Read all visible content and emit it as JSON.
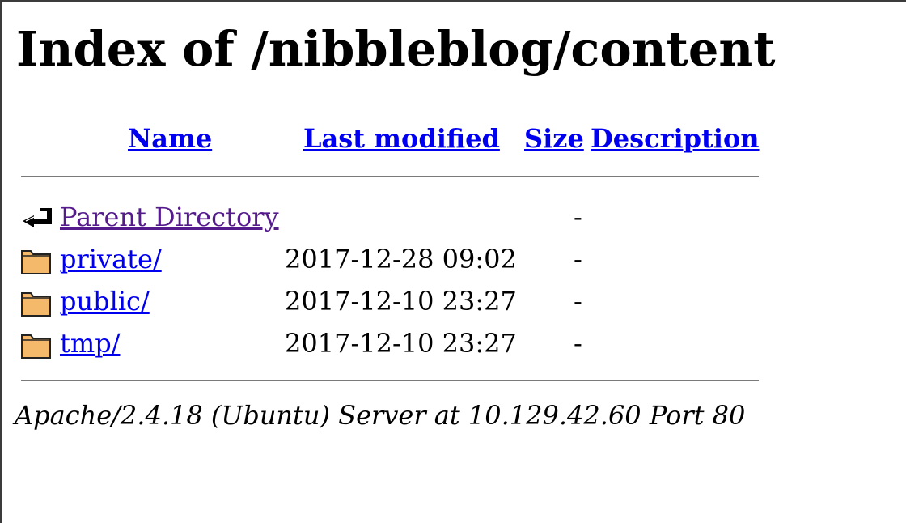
{
  "page": {
    "heading": "Index of /nibbleblog/content"
  },
  "table": {
    "headers": {
      "name": "Name",
      "last_modified": "Last modified",
      "size": "Size",
      "description": "Description"
    },
    "rows": [
      {
        "icon": "back-arrow-icon",
        "name": "Parent Directory",
        "last_modified": "",
        "size": "-",
        "description": "",
        "visited": true
      },
      {
        "icon": "folder-icon",
        "name": "private/",
        "last_modified": "2017-12-28 09:02",
        "size": "-",
        "description": ""
      },
      {
        "icon": "folder-icon",
        "name": "public/",
        "last_modified": "2017-12-10 23:27",
        "size": "-",
        "description": ""
      },
      {
        "icon": "folder-icon",
        "name": "tmp/",
        "last_modified": "2017-12-10 23:27",
        "size": "-",
        "description": ""
      }
    ]
  },
  "footer": {
    "address": "Apache/2.4.18 (Ubuntu) Server at 10.129.42.60 Port 80"
  },
  "colors": {
    "link": "#0000ee",
    "visited_link": "#551a8b",
    "folder_fill": "#f5b96b",
    "rule": "#7a7a7a"
  }
}
